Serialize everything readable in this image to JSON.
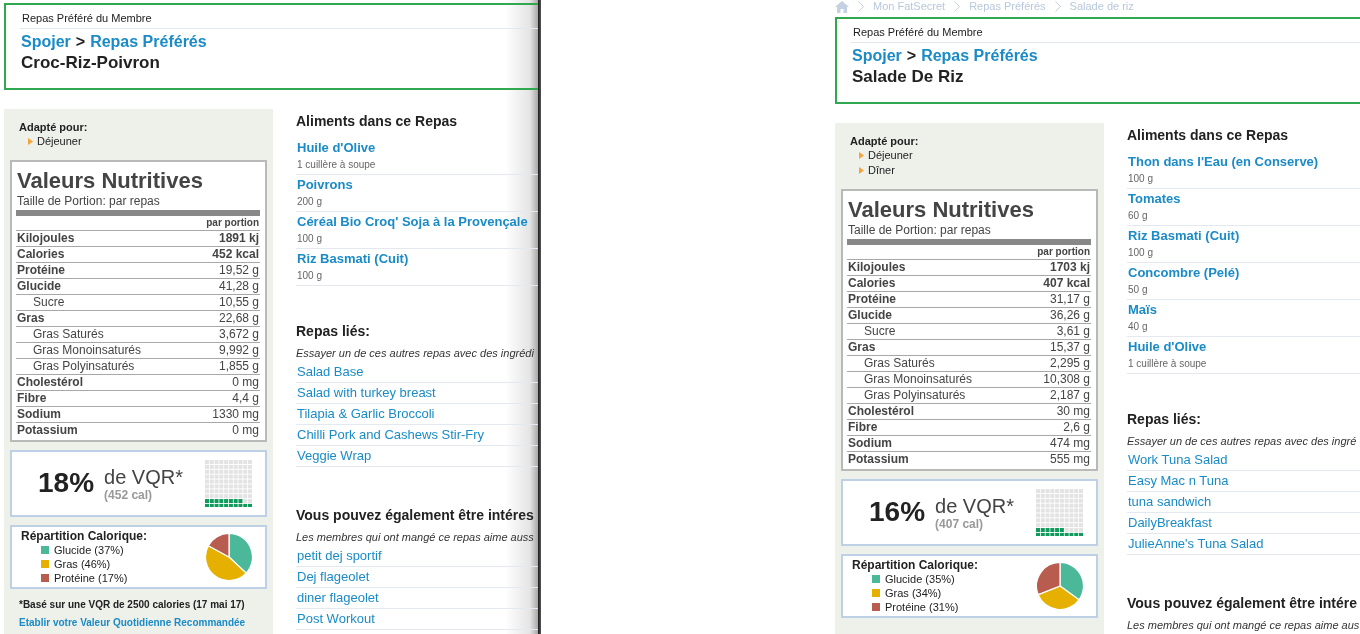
{
  "windows": [
    {
      "header": {
        "caption": "Repas Préféré du Membre",
        "member": "Spojer",
        "separator": ">",
        "section": "Repas Préférés",
        "title": "Croc-Riz-Poivron"
      },
      "suited_for": {
        "label": "Adapté pour:",
        "items": [
          "Déjeuner"
        ]
      },
      "nutrition": {
        "title": "Valeurs Nutritives",
        "serving": "Taille de Portion: par repas",
        "column": "par portion",
        "rows": [
          {
            "label": "Kilojoules",
            "value": "1891 kj",
            "kind": "energy"
          },
          {
            "label": "Calories",
            "value": "452 kcal",
            "kind": "energy"
          },
          {
            "label": "Protéine",
            "value": "19,52 g",
            "kind": "main"
          },
          {
            "label": "Glucide",
            "value": "41,28 g",
            "kind": "main"
          },
          {
            "label": "Sucre",
            "value": "10,55 g",
            "kind": "sub"
          },
          {
            "label": "Gras",
            "value": "22,68 g",
            "kind": "main"
          },
          {
            "label": "Gras Saturés",
            "value": "3,672 g",
            "kind": "sub"
          },
          {
            "label": "Gras Monoinsaturés",
            "value": "9,992 g",
            "kind": "sub"
          },
          {
            "label": "Gras Polyinsaturés",
            "value": "1,855 g",
            "kind": "sub"
          },
          {
            "label": "Cholestérol",
            "value": "0 mg",
            "kind": "main"
          },
          {
            "label": "Fibre",
            "value": "4,4 g",
            "kind": "main"
          },
          {
            "label": "Sodium",
            "value": "1330 mg",
            "kind": "main"
          },
          {
            "label": "Potassium",
            "value": "0 mg",
            "kind": "main"
          }
        ]
      },
      "daily_value": {
        "percent": "18%",
        "label": "de VQR*",
        "calories": "(452 cal)",
        "level": 0.18
      },
      "breakdown": {
        "title": "Répartition Calorique:",
        "legend": [
          {
            "label": "Glucide (37%)",
            "color": "#4cb89a"
          },
          {
            "label": "Gras (46%)",
            "color": "#e5b000"
          },
          {
            "label": "Protéine (17%)",
            "color": "#b95c50"
          }
        ],
        "chart_data": {
          "type": "pie",
          "values": [
            37,
            46,
            17
          ]
        }
      },
      "footnote": "*Basé sur une VQR de 2500 calories (17 mai 17)",
      "daily_value_link": "Etablir votre Valeur Quotidienne Recommandée",
      "foods": {
        "title": "Aliments dans ce Repas",
        "items": [
          {
            "name": "Huile d'Olive",
            "amount": "1 cuillère à soupe"
          },
          {
            "name": "Poivrons",
            "amount": "200 g"
          },
          {
            "name": "Céréal Bio Croq' Soja à la Provençale",
            "amount": "100 g"
          },
          {
            "name": "Riz Basmati (Cuit)",
            "amount": "100 g"
          }
        ]
      },
      "related": {
        "title": "Repas liés:",
        "note": "Essayer un de ces autres repas avec des ingrédi",
        "links": [
          "Salad Base",
          "Salad with turkey breast",
          "Tilapia & Garlic Broccoli",
          "Chilli Pork and Cashews Stir-Fry",
          "Veggie Wrap"
        ]
      },
      "also_liked": {
        "title": "Vous pouvez également être intéres",
        "note": "Les membres qui ont mangé ce repas aime auss",
        "links": [
          "petit dej sportif",
          "Dej flageolet",
          "diner flageolet",
          "Post Workout"
        ]
      }
    },
    {
      "breadcrumb": [
        "Mon FatSecret",
        "Repas Préférés",
        "Salade de riz"
      ],
      "header": {
        "caption": "Repas Préféré du Membre",
        "member": "Spojer",
        "separator": ">",
        "section": "Repas Préférés",
        "title": "Salade De Riz"
      },
      "suited_for": {
        "label": "Adapté pour:",
        "items": [
          "Déjeuner",
          "Dîner"
        ]
      },
      "nutrition": {
        "title": "Valeurs Nutritives",
        "serving": "Taille de Portion: par repas",
        "column": "par portion",
        "rows": [
          {
            "label": "Kilojoules",
            "value": "1703 kj",
            "kind": "energy"
          },
          {
            "label": "Calories",
            "value": "407 kcal",
            "kind": "energy"
          },
          {
            "label": "Protéine",
            "value": "31,17 g",
            "kind": "main"
          },
          {
            "label": "Glucide",
            "value": "36,26 g",
            "kind": "main"
          },
          {
            "label": "Sucre",
            "value": "3,61 g",
            "kind": "sub"
          },
          {
            "label": "Gras",
            "value": "15,37 g",
            "kind": "main"
          },
          {
            "label": "Gras Saturés",
            "value": "2,295 g",
            "kind": "sub"
          },
          {
            "label": "Gras Monoinsaturés",
            "value": "10,308 g",
            "kind": "sub"
          },
          {
            "label": "Gras Polyinsaturés",
            "value": "2,187 g",
            "kind": "sub"
          },
          {
            "label": "Cholestérol",
            "value": "30 mg",
            "kind": "main"
          },
          {
            "label": "Fibre",
            "value": "2,6 g",
            "kind": "main"
          },
          {
            "label": "Sodium",
            "value": "474 mg",
            "kind": "main"
          },
          {
            "label": "Potassium",
            "value": "555 mg",
            "kind": "main"
          }
        ]
      },
      "daily_value": {
        "percent": "16%",
        "label": "de VQR*",
        "calories": "(407 cal)",
        "level": 0.16
      },
      "breakdown": {
        "title": "Répartition Calorique:",
        "legend": [
          {
            "label": "Glucide (35%)",
            "color": "#4cb89a"
          },
          {
            "label": "Gras (34%)",
            "color": "#e5b000"
          },
          {
            "label": "Protéine (31%)",
            "color": "#b95c50"
          }
        ],
        "chart_data": {
          "type": "pie",
          "values": [
            35,
            34,
            31
          ]
        }
      },
      "foods": {
        "title": "Aliments dans ce Repas",
        "items": [
          {
            "name": "Thon dans l'Eau (en Conserve)",
            "amount": "100 g"
          },
          {
            "name": "Tomates",
            "amount": "60 g"
          },
          {
            "name": "Riz Basmati (Cuit)",
            "amount": "100 g"
          },
          {
            "name": "Concombre (Pelé)",
            "amount": "50 g"
          },
          {
            "name": "Maïs",
            "amount": "40 g"
          },
          {
            "name": "Huile d'Olive",
            "amount": "1 cuillère à soupe"
          }
        ]
      },
      "related": {
        "title": "Repas liés:",
        "note": "Essayer un de ces autres repas avec des ingré",
        "links": [
          "Work Tuna Salad",
          "Easy Mac n Tuna",
          "tuna sandwich",
          "DailyBreakfast",
          "JulieAnne's Tuna Salad"
        ]
      },
      "also_liked": {
        "title": "Vous pouvez également être intére",
        "note": "Les membres qui ont mangé ce repas aime aus"
      }
    }
  ]
}
